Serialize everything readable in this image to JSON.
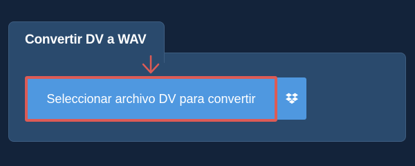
{
  "tab": {
    "title": "Convertir DV a WAV"
  },
  "upload": {
    "button_label": "Seleccionar archivo DV para convertir"
  },
  "icons": {
    "dropbox": "dropbox-icon",
    "highlight_arrow": "arrow-down-icon"
  },
  "colors": {
    "page_background": "#13233a",
    "panel_background": "#2a4a6d",
    "button_blue": "#4f98e0",
    "highlight_red": "#dd5b55"
  }
}
